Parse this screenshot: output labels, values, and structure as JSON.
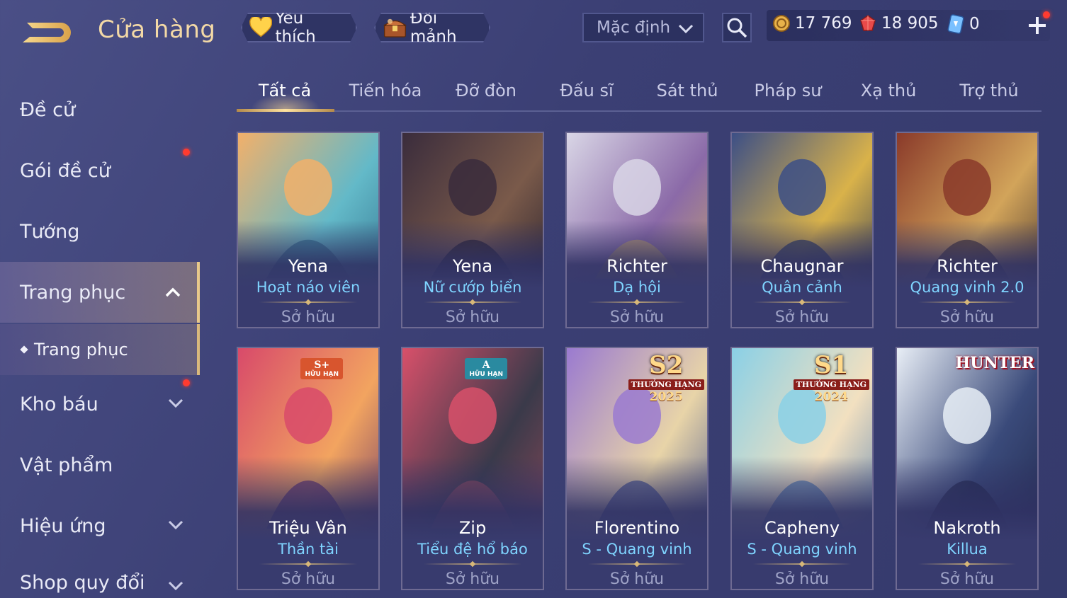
{
  "header": {
    "title": "Cửa hàng",
    "favorites_label": "Yêu thích",
    "shard_exchange_label": "Đổi mảnh",
    "sort_dropdown": "Mặc định"
  },
  "currencies": [
    {
      "name": "gold",
      "value": "17 769"
    },
    {
      "name": "ruby",
      "value": "18 905"
    },
    {
      "name": "gem",
      "value": "0"
    }
  ],
  "sidebar": {
    "items": [
      {
        "label": "Đề cử"
      },
      {
        "label": "Gói đề cử"
      },
      {
        "label": "Tướng"
      },
      {
        "label": "Trang phục"
      },
      {
        "label": "Trang phục"
      },
      {
        "label": "Kho báu"
      },
      {
        "label": "Vật phẩm"
      },
      {
        "label": "Hiệu ứng"
      },
      {
        "label": "Shop quy đổi"
      }
    ]
  },
  "tabs": [
    {
      "label": "Tất cả"
    },
    {
      "label": "Tiến hóa"
    },
    {
      "label": "Đỡ đòn"
    },
    {
      "label": "Đấu sĩ"
    },
    {
      "label": "Sát thủ"
    },
    {
      "label": "Pháp sư"
    },
    {
      "label": "Xạ thủ"
    },
    {
      "label": "Trợ thủ"
    }
  ],
  "cards": [
    {
      "hero": "Yena",
      "skin": "Hoạt náo viên",
      "status": "Sở hữu",
      "palette": [
        "#f2b06a",
        "#63b9c8",
        "#2f6d8a"
      ]
    },
    {
      "hero": "Yena",
      "skin": "Nữ cướp biển",
      "status": "Sở hữu",
      "palette": [
        "#3a2c3c",
        "#7a5a4a",
        "#1f1a2a"
      ]
    },
    {
      "hero": "Richter",
      "skin": "Dạ hội",
      "status": "Sở hữu",
      "palette": [
        "#d9d6e6",
        "#8b6aa8",
        "#c9a868"
      ]
    },
    {
      "hero": "Chaugnar",
      "skin": "Quân cảnh",
      "status": "Sở hữu",
      "palette": [
        "#3c4f86",
        "#d9b24a",
        "#20305a"
      ]
    },
    {
      "hero": "Richter",
      "skin": "Quang vinh 2.0",
      "status": "Sở hữu",
      "palette": [
        "#8a3a2a",
        "#d2a45a",
        "#3a2a2a"
      ]
    },
    {
      "hero": "Triệu Vân",
      "skin": "Thần tài",
      "status": "Sở hữu",
      "palette": [
        "#d84a6a",
        "#f2a460",
        "#5a2a6a"
      ],
      "badge": {
        "tier": "S+",
        "text": "HỮU HẠN",
        "color": "#d8552e"
      }
    },
    {
      "hero": "Zip",
      "skin": "Tiểu đệ hổ báo",
      "status": "Sở hữu",
      "palette": [
        "#d8506a",
        "#3a3a4a",
        "#9a4a5a"
      ],
      "badge": {
        "tier": "A",
        "text": "HỮU HẠN",
        "color": "#2a8aa0"
      }
    },
    {
      "hero": "Florentino",
      "skin": "S - Quang vinh",
      "status": "Sở hữu",
      "palette": [
        "#9a7ad0",
        "#e8d4a8",
        "#3a4a8a"
      ],
      "badge": {
        "rank": "S2",
        "text": "THƯỞNG HẠNG",
        "year": "2025"
      }
    },
    {
      "hero": "Capheny",
      "skin": "S - Quang vinh",
      "status": "Sở hữu",
      "palette": [
        "#8ad0e6",
        "#f2e0c0",
        "#4a7ab0"
      ],
      "badge": {
        "rank": "S1",
        "text": "THƯỞNG HẠNG",
        "year": "2024"
      }
    },
    {
      "hero": "Nakroth",
      "skin": "Killua",
      "status": "Sở hữu",
      "palette": [
        "#e8eef6",
        "#3a4a7a",
        "#1e2446"
      ],
      "badge": {
        "logo": "HUNTER"
      }
    }
  ],
  "colors": {
    "accent_gold": "#f3d9a6",
    "skin_name_blue": "#7fd4ff",
    "notification_red": "#ff3b30"
  }
}
